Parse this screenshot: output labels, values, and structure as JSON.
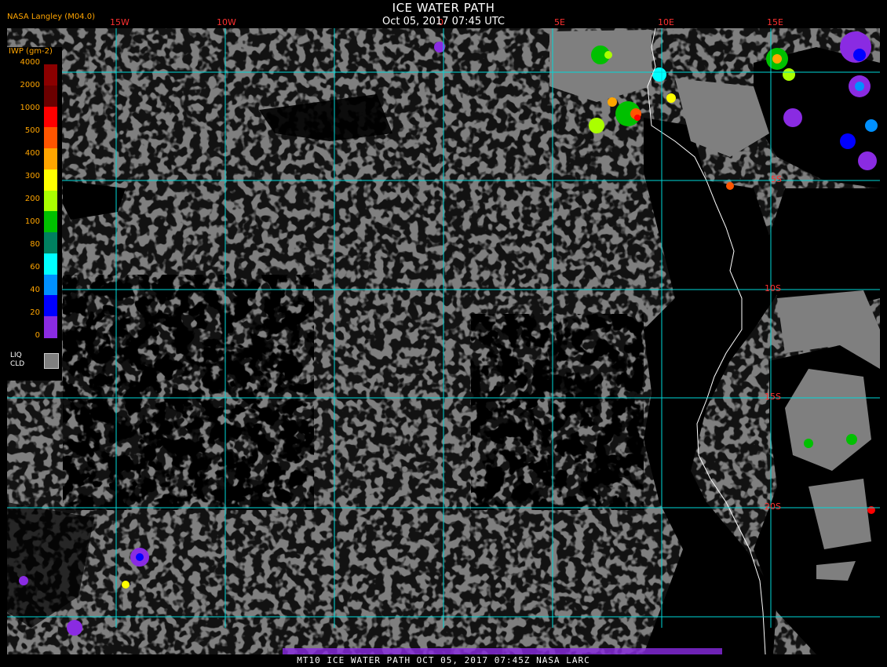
{
  "header": {
    "title": "ICE WATER PATH",
    "subtitle": "Oct 05, 2017 07:45 UTC",
    "credit": "NASA Langley (M04.0)"
  },
  "legend": {
    "title": "IWP (gm-2)",
    "labels": [
      "4000",
      "2000",
      "1000",
      "500",
      "400",
      "300",
      "200",
      "100",
      "80",
      "60",
      "40",
      "20",
      "0"
    ],
    "colors": [
      "#8b0000",
      "#6b0000",
      "#ff0000",
      "#ff5500",
      "#ffa500",
      "#ffff00",
      "#aaff00",
      "#00c000",
      "#008060",
      "#00ffff",
      "#0090ff",
      "#0000ff",
      "#8a2be2"
    ],
    "liq_label": "LIQ CLD",
    "liq_color": "#7f7f7f"
  },
  "longitude_labels": [
    "15W",
    "10W",
    "0",
    "5E",
    "10E",
    "15E"
  ],
  "latitude_labels": [
    "5S",
    "10S",
    "15S",
    "20S"
  ],
  "footer": "MT10   ICE WATER PATH   OCT 05, 2017 07:45Z   NASA LARC",
  "colors": {
    "grid": "#00d8d8",
    "tick_label": "#ff3030",
    "cloud": "#7f7f7f",
    "clear": "#000000",
    "coastline": "#ffffff"
  }
}
